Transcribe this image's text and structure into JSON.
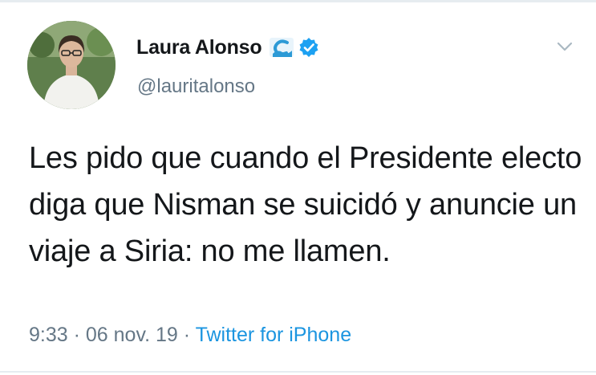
{
  "tweet": {
    "author": {
      "display_name": "Laura Alonso",
      "handle": "@lauritalonso",
      "verified": true,
      "avatar_icon": "profile-photo"
    },
    "icons": {
      "party_badge": "wave-icon",
      "verified_badge": "verified-icon",
      "menu": "chevron-down-icon"
    },
    "text": "Les pido que cuando el Presidente electo diga que Nisman se suicidó y anuncie un viaje a Siria: no me llamen.",
    "time": "9:33",
    "separator": " · ",
    "date": "06 nov. 19",
    "source": "Twitter for iPhone"
  },
  "colors": {
    "text": "#14171a",
    "secondary": "#657786",
    "link": "#1b95e0",
    "verified": "#1da1f2",
    "party": "#2c9ad6"
  }
}
